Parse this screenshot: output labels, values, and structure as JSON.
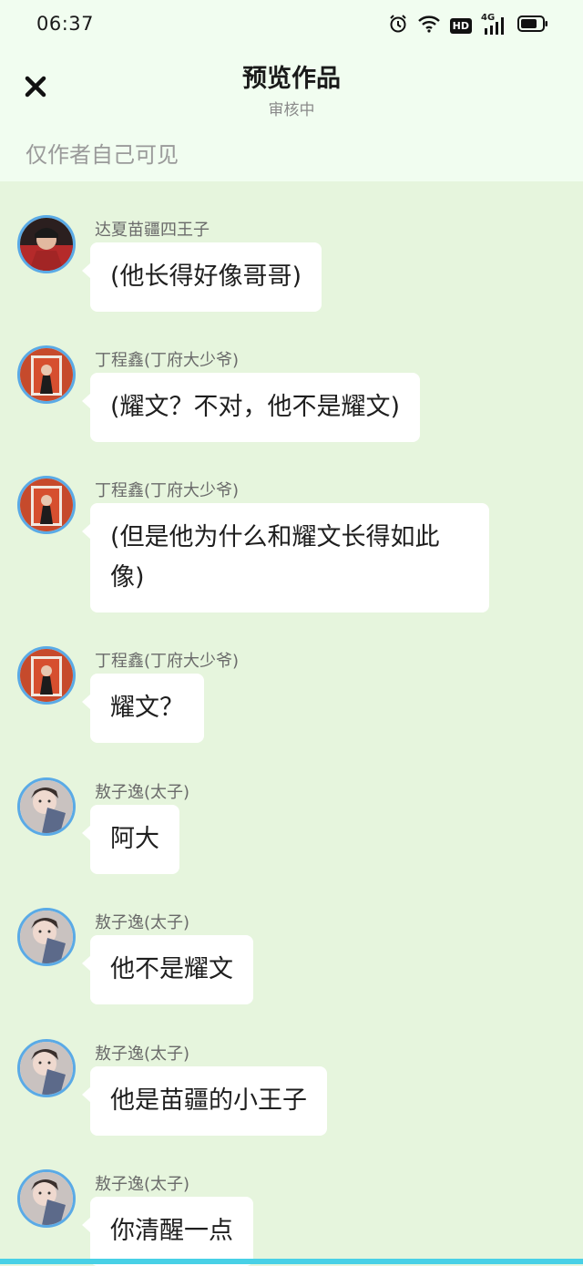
{
  "status_bar": {
    "time": "06:37",
    "hd_label": "HD",
    "network_label": "4G"
  },
  "header": {
    "title": "预览作品",
    "subtitle": "审核中",
    "visibility_note": "仅作者自己可见"
  },
  "messages": [
    {
      "name": "达夏苗疆四王子",
      "text": "(他长得好像哥哥)",
      "avatar": "warrior-avatar"
    },
    {
      "name": "丁程鑫(丁府大少爷)",
      "text": "(耀文？不对，他不是耀文)",
      "avatar": "red-robe-avatar"
    },
    {
      "name": "丁程鑫(丁府大少爷)",
      "text": "(但是他为什么和耀文长得如此像)",
      "avatar": "red-robe-avatar"
    },
    {
      "name": "丁程鑫(丁府大少爷)",
      "text": "耀文？",
      "avatar": "red-robe-avatar"
    },
    {
      "name": "敖子逸(太子)",
      "text": "阿大",
      "avatar": "prince-avatar"
    },
    {
      "name": "敖子逸(太子)",
      "text": "他不是耀文",
      "avatar": "prince-avatar"
    },
    {
      "name": "敖子逸(太子)",
      "text": "他是苗疆的小王子",
      "avatar": "prince-avatar"
    },
    {
      "name": "敖子逸(太子)",
      "text": "你清醒一点",
      "avatar": "prince-avatar"
    }
  ],
  "colors": {
    "background": "#e6f5dd",
    "header_bg": "#f1fdf0",
    "bubble": "#ffffff",
    "avatar_ring": "#5aaae6",
    "bottom_bar": "#48d0e6"
  }
}
